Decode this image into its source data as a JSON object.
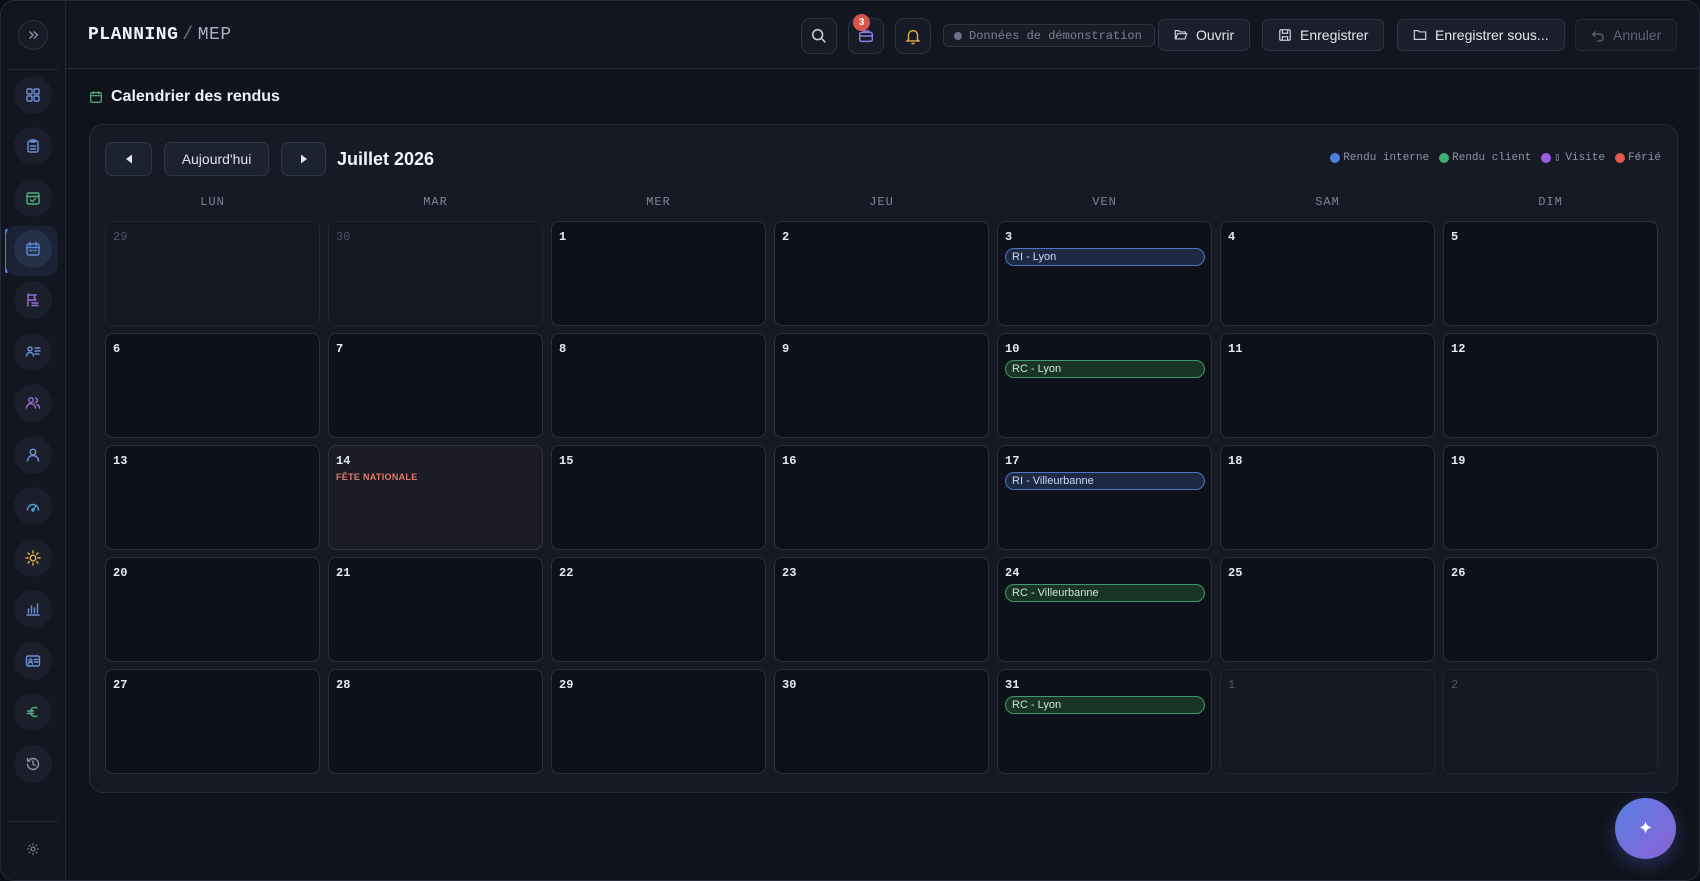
{
  "header": {
    "crumb_root": "PLANNING",
    "crumb_sep": "/",
    "crumb_leaf": "MEP",
    "notification_count": "3",
    "demo_label": "Données de démonstration",
    "open_label": "Ouvrir",
    "save_label": "Enregistrer",
    "save_as_label": "Enregistrer sous...",
    "undo_label": "Annuler"
  },
  "sidebar": {
    "items": [
      {
        "icon": "grid-icon",
        "color": "#6d8fd6"
      },
      {
        "icon": "clipboard-icon",
        "color": "#6d8fd6"
      },
      {
        "icon": "calendar-check-icon",
        "color": "#4fb083"
      },
      {
        "icon": "calendar-icon",
        "color": "#5c8ae0",
        "active": true
      },
      {
        "icon": "list-flag-icon",
        "color": "#9a6fd6"
      },
      {
        "icon": "team-list-icon",
        "color": "#6d8fd6"
      },
      {
        "icon": "users-icon",
        "color": "#9a6fd6"
      },
      {
        "icon": "user-icon",
        "color": "#6d8fd6"
      },
      {
        "icon": "gauge-icon",
        "color": "#4fa0d0"
      },
      {
        "icon": "sun-icon",
        "color": "#e0b048"
      },
      {
        "icon": "bar-chart-icon",
        "color": "#6d8fd6"
      },
      {
        "icon": "id-card-icon",
        "color": "#6d8fd6"
      },
      {
        "icon": "euro-icon",
        "color": "#4fb083"
      },
      {
        "icon": "history-icon",
        "color": "#8a91a3"
      }
    ]
  },
  "section": {
    "title": "Calendrier des rendus"
  },
  "calendar": {
    "today_label": "Aujourd'hui",
    "month_label": "Juillet 2026",
    "legend": [
      {
        "label": "Rendu interne",
        "color": "#4d7fe0"
      },
      {
        "label": "Rendu client",
        "color": "#3fae72"
      },
      {
        "label": "Visite",
        "color": "#9a5fe0"
      },
      {
        "label": "Férié",
        "color": "#e05a4d"
      }
    ],
    "weekdays": [
      "LUN",
      "MAR",
      "MER",
      "JEU",
      "VEN",
      "SAM",
      "DIM"
    ],
    "weeks": [
      [
        {
          "day": "29",
          "out": true
        },
        {
          "day": "30",
          "out": true
        },
        {
          "day": "1"
        },
        {
          "day": "2"
        },
        {
          "day": "3",
          "event": {
            "label": "RI - Lyon",
            "type": "ri"
          }
        },
        {
          "day": "4"
        },
        {
          "day": "5"
        }
      ],
      [
        {
          "day": "6"
        },
        {
          "day": "7"
        },
        {
          "day": "8"
        },
        {
          "day": "9"
        },
        {
          "day": "10",
          "event": {
            "label": "RC - Lyon",
            "type": "rc"
          }
        },
        {
          "day": "11"
        },
        {
          "day": "12"
        }
      ],
      [
        {
          "day": "13"
        },
        {
          "day": "14",
          "holiday": "FÊTE NATIONALE"
        },
        {
          "day": "15"
        },
        {
          "day": "16"
        },
        {
          "day": "17",
          "event": {
            "label": "RI - Villeurbanne",
            "type": "ri"
          }
        },
        {
          "day": "18"
        },
        {
          "day": "19"
        }
      ],
      [
        {
          "day": "20"
        },
        {
          "day": "21"
        },
        {
          "day": "22"
        },
        {
          "day": "23"
        },
        {
          "day": "24",
          "event": {
            "label": "RC - Villeurbanne",
            "type": "rc"
          }
        },
        {
          "day": "25"
        },
        {
          "day": "26"
        }
      ],
      [
        {
          "day": "27"
        },
        {
          "day": "28"
        },
        {
          "day": "29"
        },
        {
          "day": "30"
        },
        {
          "day": "31",
          "event": {
            "label": "RC - Lyon",
            "type": "rc"
          }
        },
        {
          "day": "1",
          "out": true
        },
        {
          "day": "2",
          "out": true
        }
      ]
    ]
  },
  "fab": {
    "icon": "sparkle-icon"
  }
}
